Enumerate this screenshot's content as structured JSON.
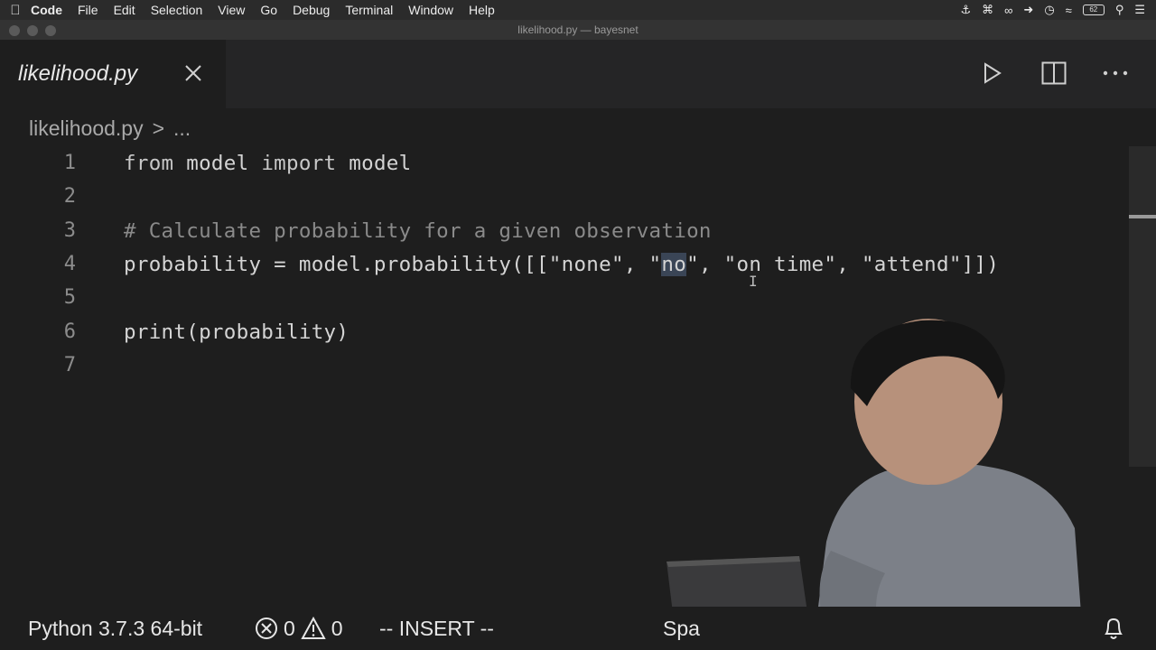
{
  "menubar": {
    "apple_icon": "apple-logo-icon",
    "app_name": "Code",
    "items": [
      "File",
      "Edit",
      "Selection",
      "View",
      "Go",
      "Debug",
      "Terminal",
      "Window",
      "Help"
    ],
    "battery_label": "62"
  },
  "window": {
    "title": "likelihood.py — bayesnet"
  },
  "tab": {
    "title": "likelihood.py"
  },
  "breadcrumb": {
    "file": "likelihood.py",
    "separator": ">",
    "more": "..."
  },
  "editor": {
    "lines": [
      {
        "number": "1"
      },
      {
        "number": "2"
      },
      {
        "number": "3"
      },
      {
        "number": "4"
      },
      {
        "number": "5"
      },
      {
        "number": "6"
      },
      {
        "number": "7"
      }
    ],
    "line1": {
      "from": "from",
      "module": " model ",
      "import": "import",
      "name": " model"
    },
    "line3": {
      "comment": "# Calculate probability for a given observation"
    },
    "line4": {
      "prefix": "probability = model.probability([[\"none\", \"",
      "selected": "no",
      "suffix": "\", \"on time\", \"attend\"]])"
    },
    "line6": {
      "code": "print(probability)"
    }
  },
  "statusbar": {
    "python": "Python 3.7.3 64-bit",
    "errors": "0",
    "warnings": "0",
    "mode": "-- INSERT --",
    "spaces": "Spa"
  },
  "colors": {
    "editor_bg": "#1e1e1e",
    "selection": "#3a4556",
    "line_number": "#8c8c8c"
  }
}
